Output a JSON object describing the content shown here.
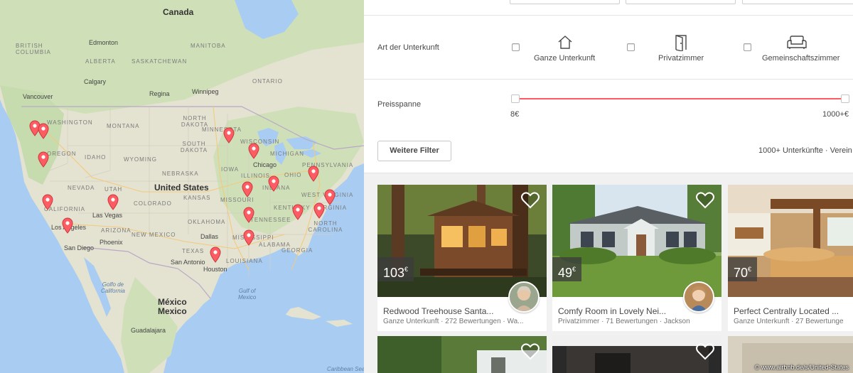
{
  "map": {
    "labels": {
      "canada": "Canada",
      "us": "United States",
      "mexico_country": "México",
      "mexico_city": "Mexico",
      "columbia": "BRITISH COLUMBIA",
      "alberta": "ALBERTA",
      "saskatchewan": "SASKATCHEWAN",
      "manitoba": "MANITOBA",
      "ontario": "ONTARIO",
      "washington": "WASHINGTON",
      "montana": "MONTANA",
      "oregon": "OREGON",
      "idaho": "IDAHO",
      "wyoming": "WYOMING",
      "north_dakota": "NORTH DAKOTA",
      "south_dakota": "SOUTH DAKOTA",
      "minnesota": "MINNESOTA",
      "wisconsin": "WISCONSIN",
      "michigan": "MICHIGAN",
      "iowa": "IOWA",
      "nebraska": "NEBRASKA",
      "nevada": "NEVADA",
      "utah": "UTAH",
      "colorado": "COLORADO",
      "kansas": "KANSAS",
      "missouri": "MISSOURI",
      "illinois": "ILLINOIS",
      "indiana": "INDIANA",
      "ohio": "OHIO",
      "pennsylvania": "PENNSYLVANIA",
      "california": "CALIFORNIA",
      "arizona": "ARIZONA",
      "new_mexico": "NEW MEXICO",
      "oklahoma": "OKLAHOMA",
      "texas": "TEXAS",
      "tennessee": "TENNESSEE",
      "kentucky": "KENTUCKY",
      "west_virginia": "WEST VIRGINIA",
      "virginia": "VIRGINIA",
      "north_carolina": "NORTH CAROLINA",
      "mississippi": "MISSISSIPPI",
      "alabama": "ALABAMA",
      "georgia": "GEORGIA",
      "louisiana": "LOUISIANA",
      "vancouver": "Vancouver",
      "calgary": "Calgary",
      "edmonton": "Edmonton",
      "winnipeg": "Winnipeg",
      "regina": "Regina",
      "chicago": "Chicago",
      "las_vegas": "Las Vegas",
      "los_angeles": "Los Angeles",
      "san_diego": "San Diego",
      "phoenix": "Phoenix",
      "dallas": "Dallas",
      "houston": "Houston",
      "san_antonio": "San Antonio",
      "gulf_mexico": "Gulf of\nMexico",
      "gulf_california": "Golfo de\nCalifornia",
      "guadalajara": "Guadalajara",
      "caribbean": "Caribbean Sea"
    }
  },
  "panel": {
    "room_type_label": "Art der Unterkunft",
    "room_types": [
      {
        "label": "Ganze Unterkunft",
        "icon": "house-icon",
        "checked": false
      },
      {
        "label": "Privatzimmer",
        "icon": "door-icon",
        "checked": false
      },
      {
        "label": "Gemeinschaftszimmer",
        "icon": "sofa-icon",
        "checked": false
      }
    ],
    "price_label": "Preisspanne",
    "price_min": "8€",
    "price_max": "1000+€",
    "more_filters": "Weitere Filter",
    "results_count": "1000+ Unterkünfte · Verein",
    "listings": [
      {
        "price": "103",
        "currency": "€",
        "title": "Redwood Treehouse Santa...",
        "meta": "Ganze Unterkunft · 272 Bewertungen · Wa..."
      },
      {
        "price": "49",
        "currency": "€",
        "title": "Comfy Room in Lovely Nei...",
        "meta": "Privatzimmer · 71 Bewertungen · Jackson"
      },
      {
        "price": "70",
        "currency": "€",
        "title": "Perfect Centrally Located ...",
        "meta": "Ganze Unterkunft · 27 Bewertunge"
      }
    ]
  },
  "credit": "© www.airbnb.de/s/United-States",
  "colors": {
    "accent": "#ff5a5f",
    "pin": "#fc5c62",
    "map_water": "#a9cdf2",
    "map_land": "#e8e4d6"
  }
}
